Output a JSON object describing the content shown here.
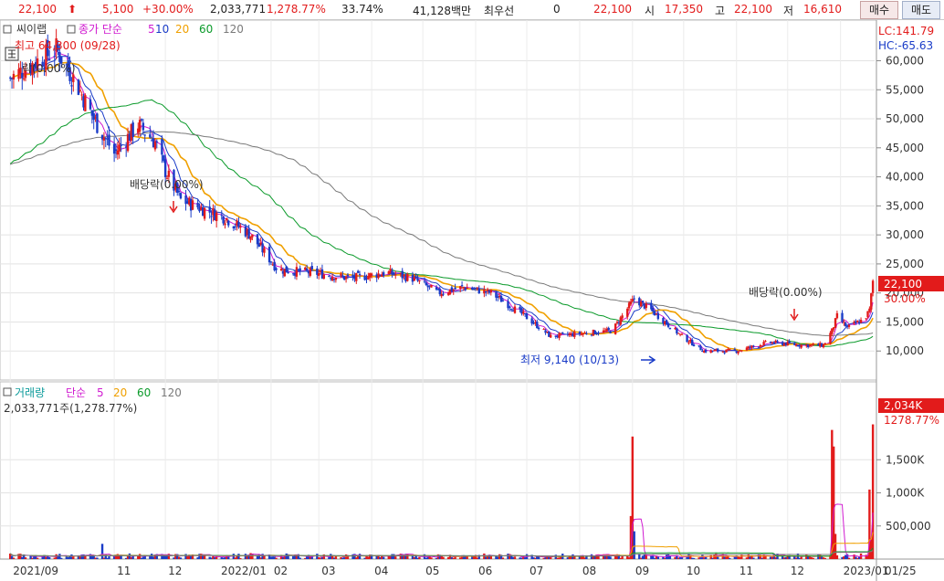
{
  "quote_bar": {
    "price": "22,100",
    "change": "5,100",
    "change_pct": "+30.00%",
    "volume": "2,033,771",
    "volume_ratio": "1,278.77%",
    "turnover": "33.74%",
    "amount": "41,128백만",
    "priority_label": "최우선",
    "priority_value": "0",
    "ask_price": "22,100",
    "open_label": "시",
    "open": "17,350",
    "high_label": "고",
    "high": "22,100",
    "low_label": "저",
    "low": "16,610",
    "buy_button": "매수",
    "sell_button": "매도"
  },
  "price_panel": {
    "stock_name": "씨이랩",
    "legend_prefix": "종가 단순",
    "ma_periods": [
      "5",
      "10",
      "20",
      "60",
      "120"
    ],
    "ma_colors": [
      "#d01ad0",
      "#1a3cc8",
      "#f0a000",
      "#0a9a2a",
      "#7a7a7a"
    ],
    "high_marker": "최고 64,300 (09/28)",
    "top_left_label": "락(0.00%)",
    "dividend_label_1": "배당락(0.00%)",
    "dividend_label_2": "배당락(0.00%)",
    "low_marker": "최저 9,140 (10/13)",
    "lc_label": "LC:141.79",
    "hc_label": "HC:-65.63",
    "current_price_tag": "22,100",
    "current_pct_tag": "30.00%",
    "y_ticks": [
      "60,000",
      "55,000",
      "50,000",
      "45,000",
      "40,000",
      "35,000",
      "30,000",
      "25,000",
      "20,000",
      "15,000",
      "10,000"
    ]
  },
  "volume_panel": {
    "title": "거래량",
    "legend_prefix": "단순",
    "ma_periods": [
      "5",
      "20",
      "60",
      "120"
    ],
    "ma_colors": [
      "#d01ad0",
      "#f0a000",
      "#0a9a2a",
      "#7a7a7a"
    ],
    "current_volume": "2,033,771주(1,278.77%)",
    "current_volume_tag": "2,034K",
    "current_volume_pct_tag": "1278.77%",
    "y_ticks": [
      "1,500K",
      "1,000K",
      "500,000"
    ]
  },
  "x_ticks": [
    "2021/09",
    "11",
    "12",
    "2022/01",
    "02",
    "03",
    "04",
    "05",
    "06",
    "07",
    "08",
    "09",
    "10",
    "11",
    "12",
    "2023/01",
    "01/25"
  ],
  "chart_data": {
    "type": "candlestick",
    "price_ylim": [
      5000,
      67000
    ],
    "volume_ylim": [
      0,
      2400000
    ],
    "price_anchors": [
      [
        "2021-09-01",
        57000
      ],
      [
        "2021-09-28",
        62000
      ],
      [
        "2021-10-10",
        56000
      ],
      [
        "2021-10-20",
        50000
      ],
      [
        "2021-11-01",
        44000
      ],
      [
        "2021-11-15",
        49000
      ],
      [
        "2021-11-25",
        46000
      ],
      [
        "2021-12-01",
        41000
      ],
      [
        "2021-12-10",
        36000
      ],
      [
        "2021-12-27",
        34000
      ],
      [
        "2022-01-05",
        33000
      ],
      [
        "2022-01-20",
        30000
      ],
      [
        "2022-02-05",
        24000
      ],
      [
        "2022-02-25",
        23500
      ],
      [
        "2022-03-20",
        22500
      ],
      [
        "2022-04-10",
        23500
      ],
      [
        "2022-04-25",
        22500
      ],
      [
        "2022-05-10",
        20000
      ],
      [
        "2022-05-25",
        21000
      ],
      [
        "2022-06-10",
        20000
      ],
      [
        "2022-06-30",
        16000
      ],
      [
        "2022-07-15",
        12500
      ],
      [
        "2022-08-01",
        13000
      ],
      [
        "2022-08-20",
        13500
      ],
      [
        "2022-09-02",
        19000
      ],
      [
        "2022-09-12",
        17000
      ],
      [
        "2022-09-30",
        12500
      ],
      [
        "2022-10-13",
        10000
      ],
      [
        "2022-11-01",
        10000
      ],
      [
        "2022-11-20",
        11500
      ],
      [
        "2022-12-10",
        11000
      ],
      [
        "2022-12-22",
        11000
      ],
      [
        "2022-12-27",
        13500
      ],
      [
        "2022-12-30",
        16000
      ],
      [
        "2023-01-05",
        14000
      ],
      [
        "2023-01-15",
        15500
      ],
      [
        "2023-01-18",
        17000
      ],
      [
        "2023-01-20",
        22100
      ]
    ],
    "volume_spikes": [
      [
        "2022-09-01",
        1850000
      ],
      [
        "2022-08-31",
        650000
      ],
      [
        "2022-09-02",
        420000
      ],
      [
        "2022-12-27",
        1950000
      ],
      [
        "2022-12-28",
        1700000
      ],
      [
        "2022-12-29",
        380000
      ],
      [
        "2023-01-18",
        1050000
      ],
      [
        "2023-01-20",
        2034000
      ],
      [
        "2023-01-19",
        300000
      ],
      [
        "2021-10-25",
        230000
      ],
      [
        "2022-01-20",
        90000
      ]
    ],
    "volume_base": 50000
  }
}
